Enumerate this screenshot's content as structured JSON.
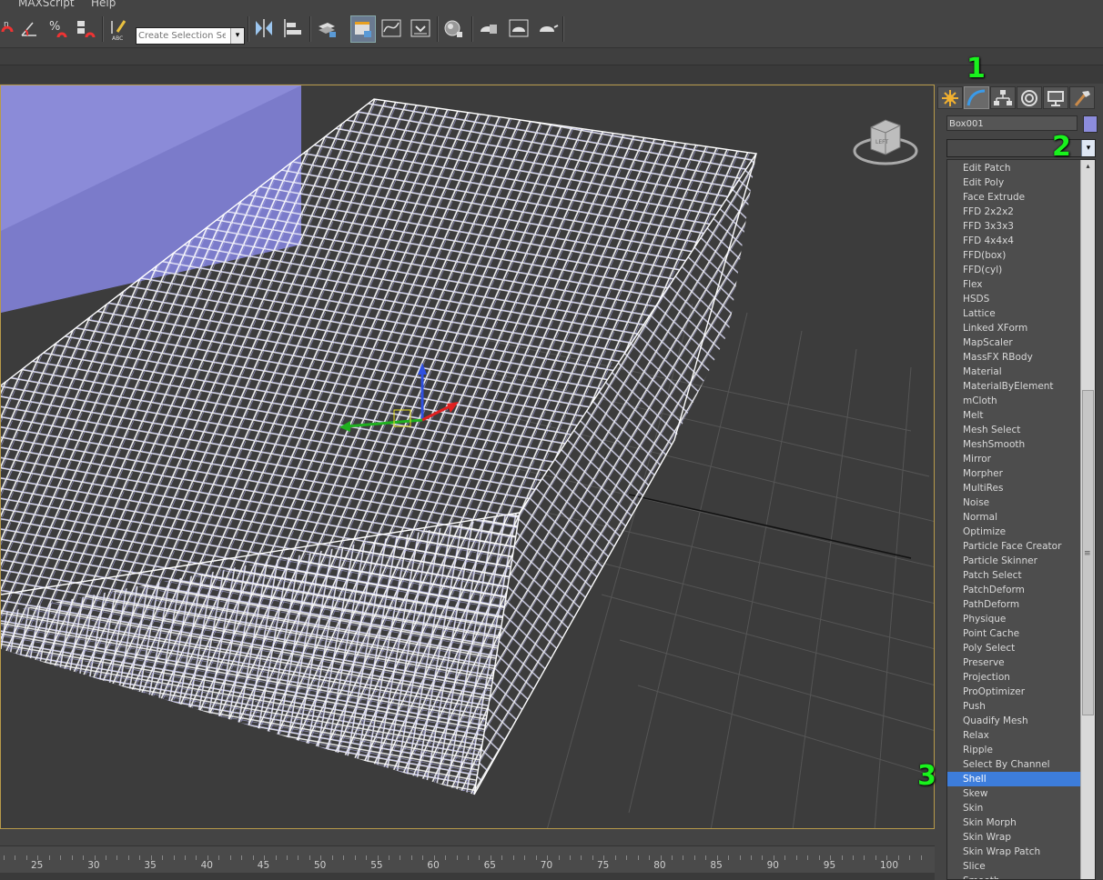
{
  "menu": {
    "maxscript": "MAXScript",
    "help": "Help"
  },
  "toolbar": {
    "named_selection_placeholder": "Create Selection Se",
    "named_selection_arrow": "▾"
  },
  "command_panel": {
    "tabs": [
      "create",
      "modify",
      "hierarchy",
      "motion",
      "display",
      "utilities"
    ],
    "active_tab": "modify",
    "object_name": "Box001",
    "object_color": "#8c8cdc",
    "modifier_list_value": "",
    "modifier_list_arrow": "▾"
  },
  "modifier_dropdown": {
    "items": [
      "Edit Patch",
      "Edit Poly",
      "Face Extrude",
      "FFD 2x2x2",
      "FFD 3x3x3",
      "FFD 4x4x4",
      "FFD(box)",
      "FFD(cyl)",
      "Flex",
      "HSDS",
      "Lattice",
      "Linked XForm",
      "MapScaler",
      "MassFX RBody",
      "Material",
      "MaterialByElement",
      "mCloth",
      "Melt",
      "Mesh Select",
      "MeshSmooth",
      "Mirror",
      "Morpher",
      "MultiRes",
      "Noise",
      "Normal",
      "Optimize",
      "Particle Face Creator",
      "Particle Skinner",
      "Patch Select",
      "PatchDeform",
      "PathDeform",
      "Physique",
      "Point Cache",
      "Poly Select",
      "Preserve",
      "Projection",
      "ProOptimizer",
      "Push",
      "Quadify Mesh",
      "Relax",
      "Ripple",
      "Select By Channel",
      "Shell",
      "Skew",
      "Skin",
      "Skin Morph",
      "Skin Wrap",
      "Skin Wrap Patch",
      "Slice",
      "Smooth"
    ],
    "selected": "Shell",
    "scroll_up_arrow": "▴",
    "scroll_grip": "≡"
  },
  "callouts": {
    "one": "1",
    "two": "2",
    "three": "3"
  },
  "timeline": {
    "ticks": [
      "25",
      "30",
      "35",
      "40",
      "45",
      "50",
      "55",
      "60",
      "65",
      "70",
      "75",
      "80",
      "85",
      "90",
      "95",
      "100"
    ]
  },
  "viewcube": {
    "label": "LEFT"
  },
  "colors": {
    "accent_selection": "#3d7ddb",
    "callout_green": "#19f21d",
    "viewport_border": "#b79a4a"
  }
}
